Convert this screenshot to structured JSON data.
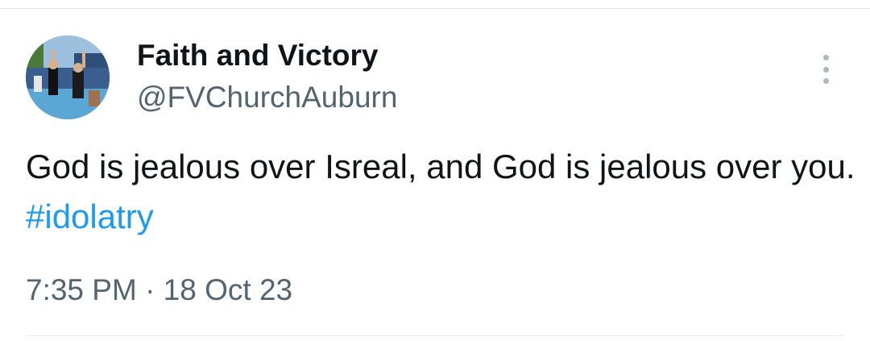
{
  "tweet": {
    "author": {
      "display_name": "Faith and Victory",
      "handle": "@FVChurchAuburn",
      "avatar_icon": "profile-photo"
    },
    "more_icon": "more-options-vertical-icon",
    "text_before": "God is jealous over Isreal, and God is jealous over you. ",
    "hashtag": "#idolatry",
    "timestamp": "7:35 PM · 18 Oct 23"
  },
  "colors": {
    "hashtag": "#1d9bf0",
    "secondary_text": "#536471",
    "primary_text": "#0f1419"
  }
}
